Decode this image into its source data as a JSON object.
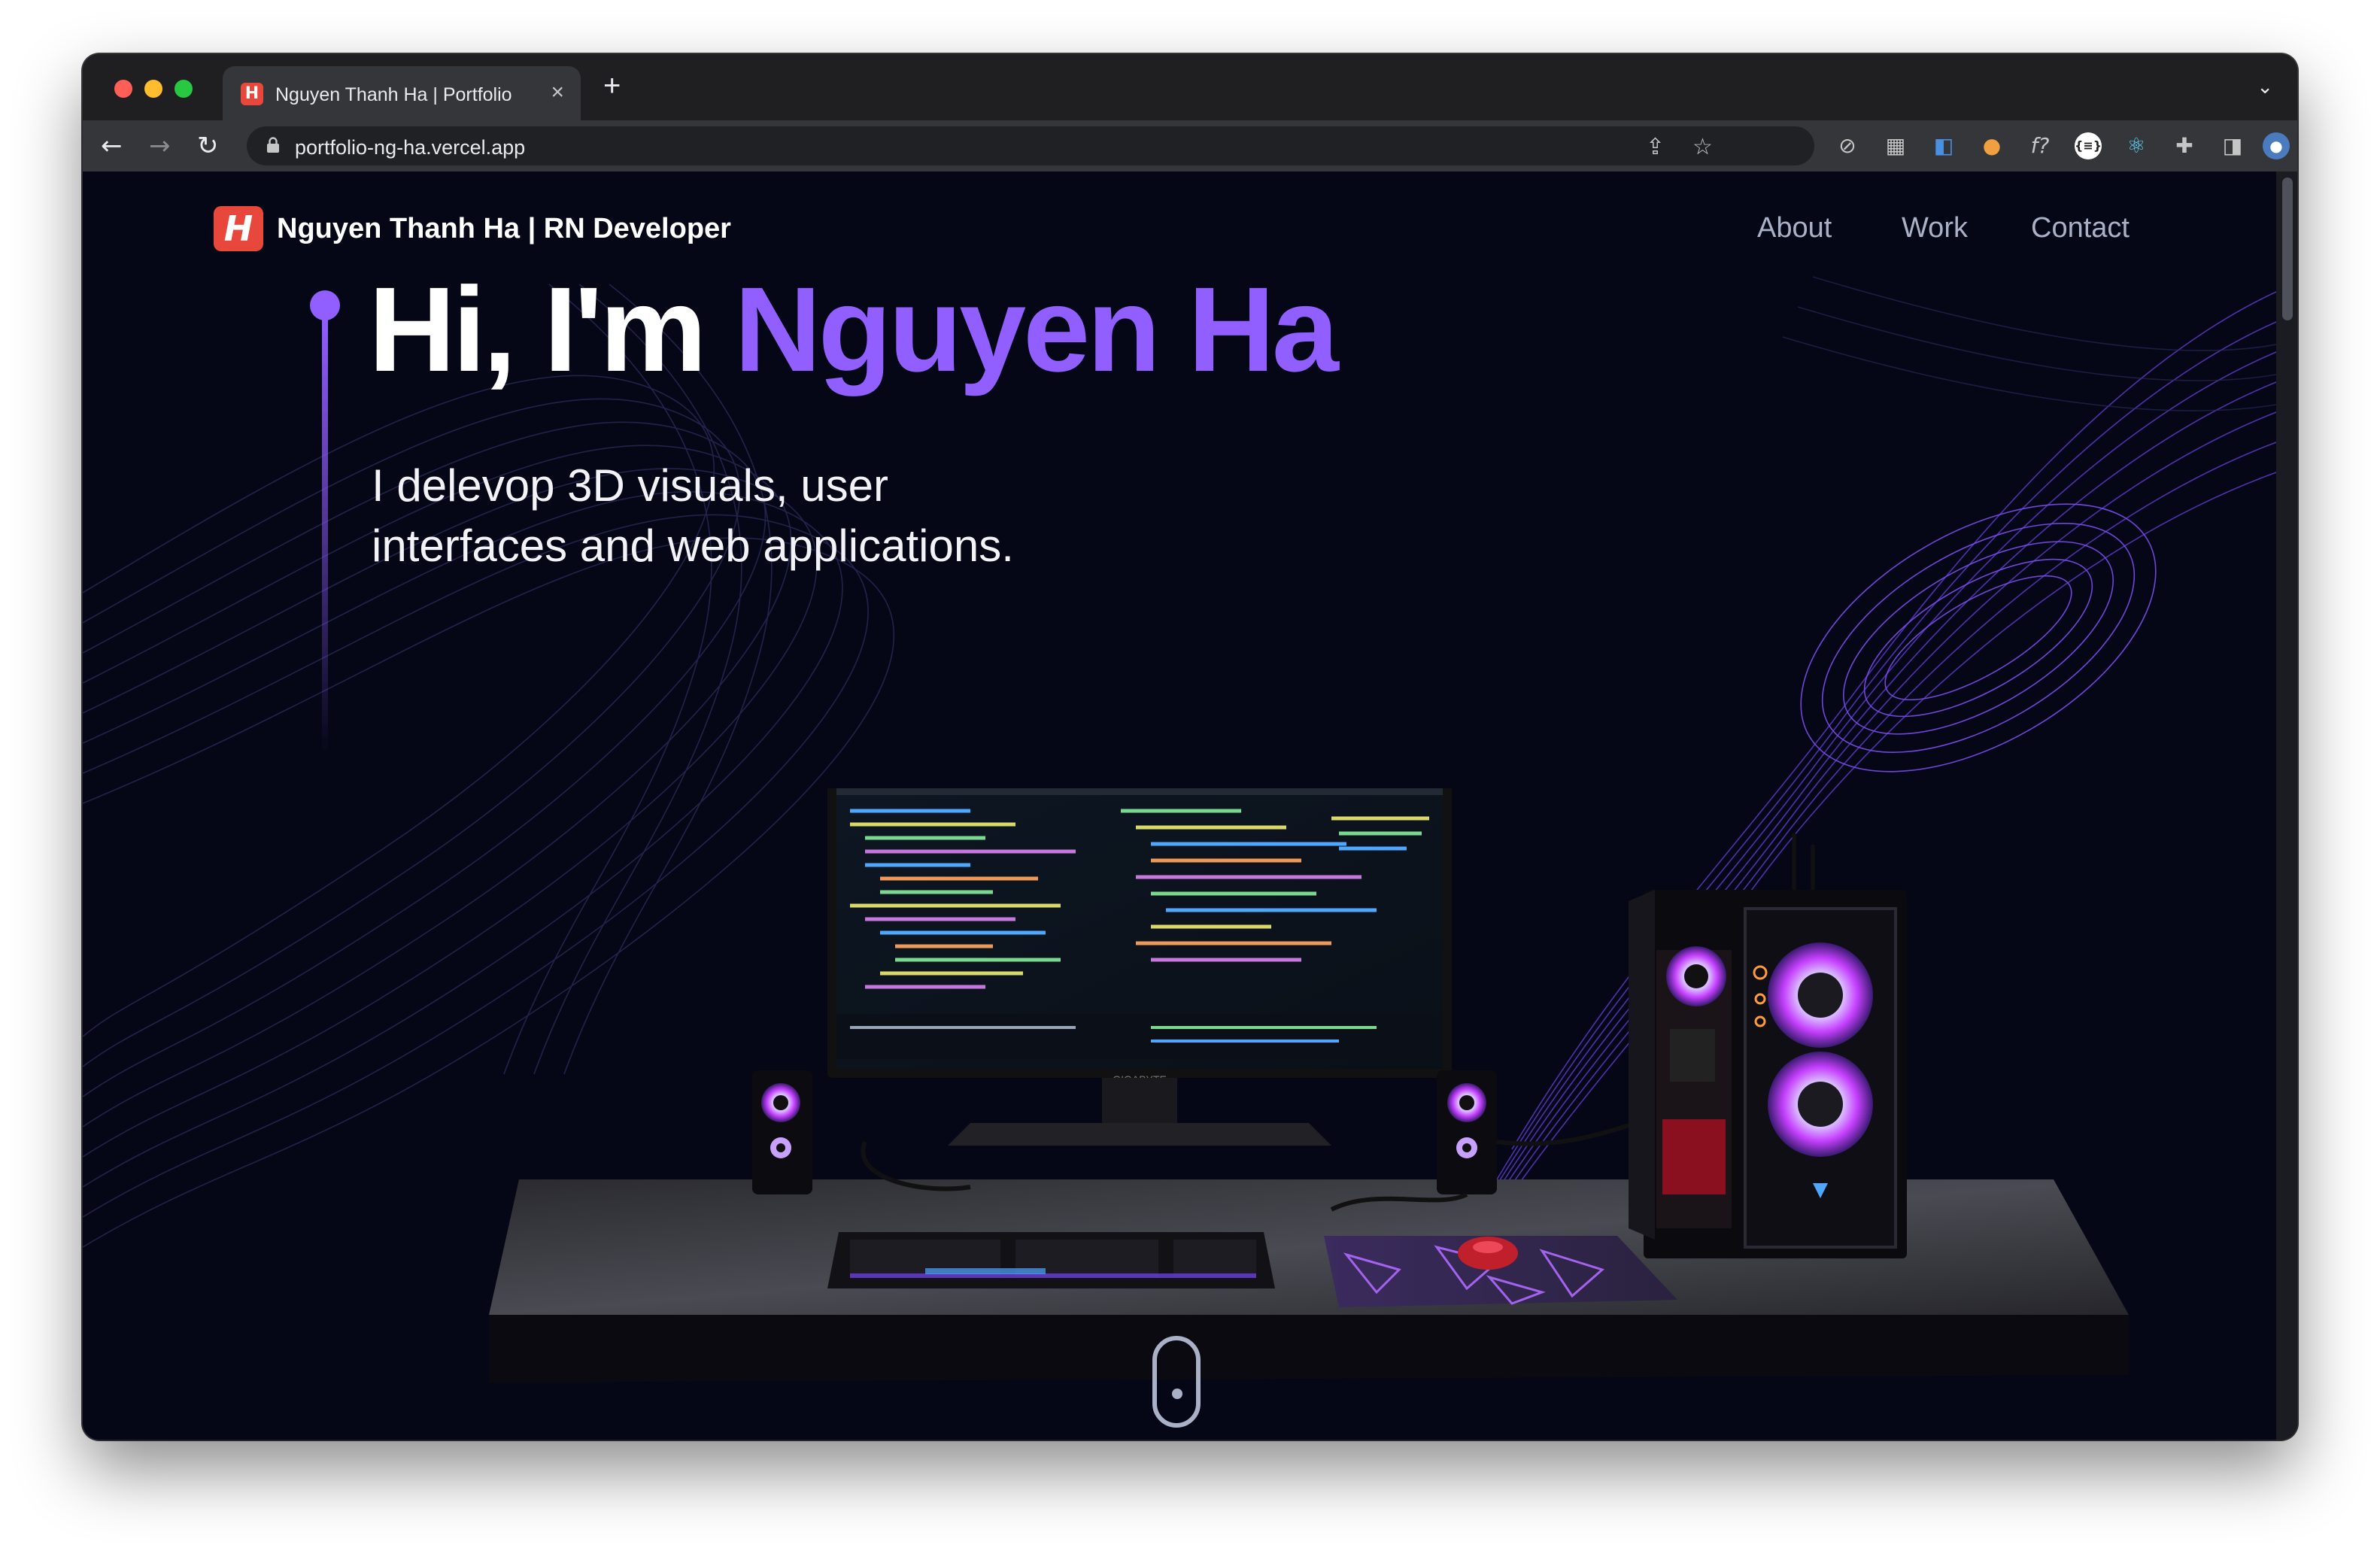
{
  "browser": {
    "tab_title": "Nguyen Thanh Ha | Portfolio",
    "tab_favicon_letter": "H",
    "tab_close": "×",
    "new_tab": "+",
    "tab_menu": "⌄",
    "url": "portfolio-ng-ha.vercel.app",
    "extensions": [
      "share-icon",
      "bookmark-star-icon",
      "compass-icon",
      "calculator-icon",
      "translate-icon",
      "egg-icon",
      "function-icon",
      "json-icon",
      "react-icon",
      "puzzle-icon",
      "sidebar-icon",
      "profile-avatar",
      "kebab-menu-icon"
    ]
  },
  "navbar": {
    "logo_letter": "H",
    "brand": "Nguyen Thanh Ha |  RN Developer",
    "links": [
      "About",
      "Work",
      "Contact"
    ]
  },
  "hero": {
    "greeting": "Hi, I'm ",
    "name": "Nguyen Ha",
    "subtitle_line1": "I delevop 3D visuals, user",
    "subtitle_line2": "interfaces and web applications."
  },
  "scene": {
    "monitor_brand": "GIGABYTE"
  },
  "colors": {
    "accent": "#915eff",
    "background": "#050716",
    "logo": "#e8473b",
    "nav_text": "#aab0c6"
  }
}
